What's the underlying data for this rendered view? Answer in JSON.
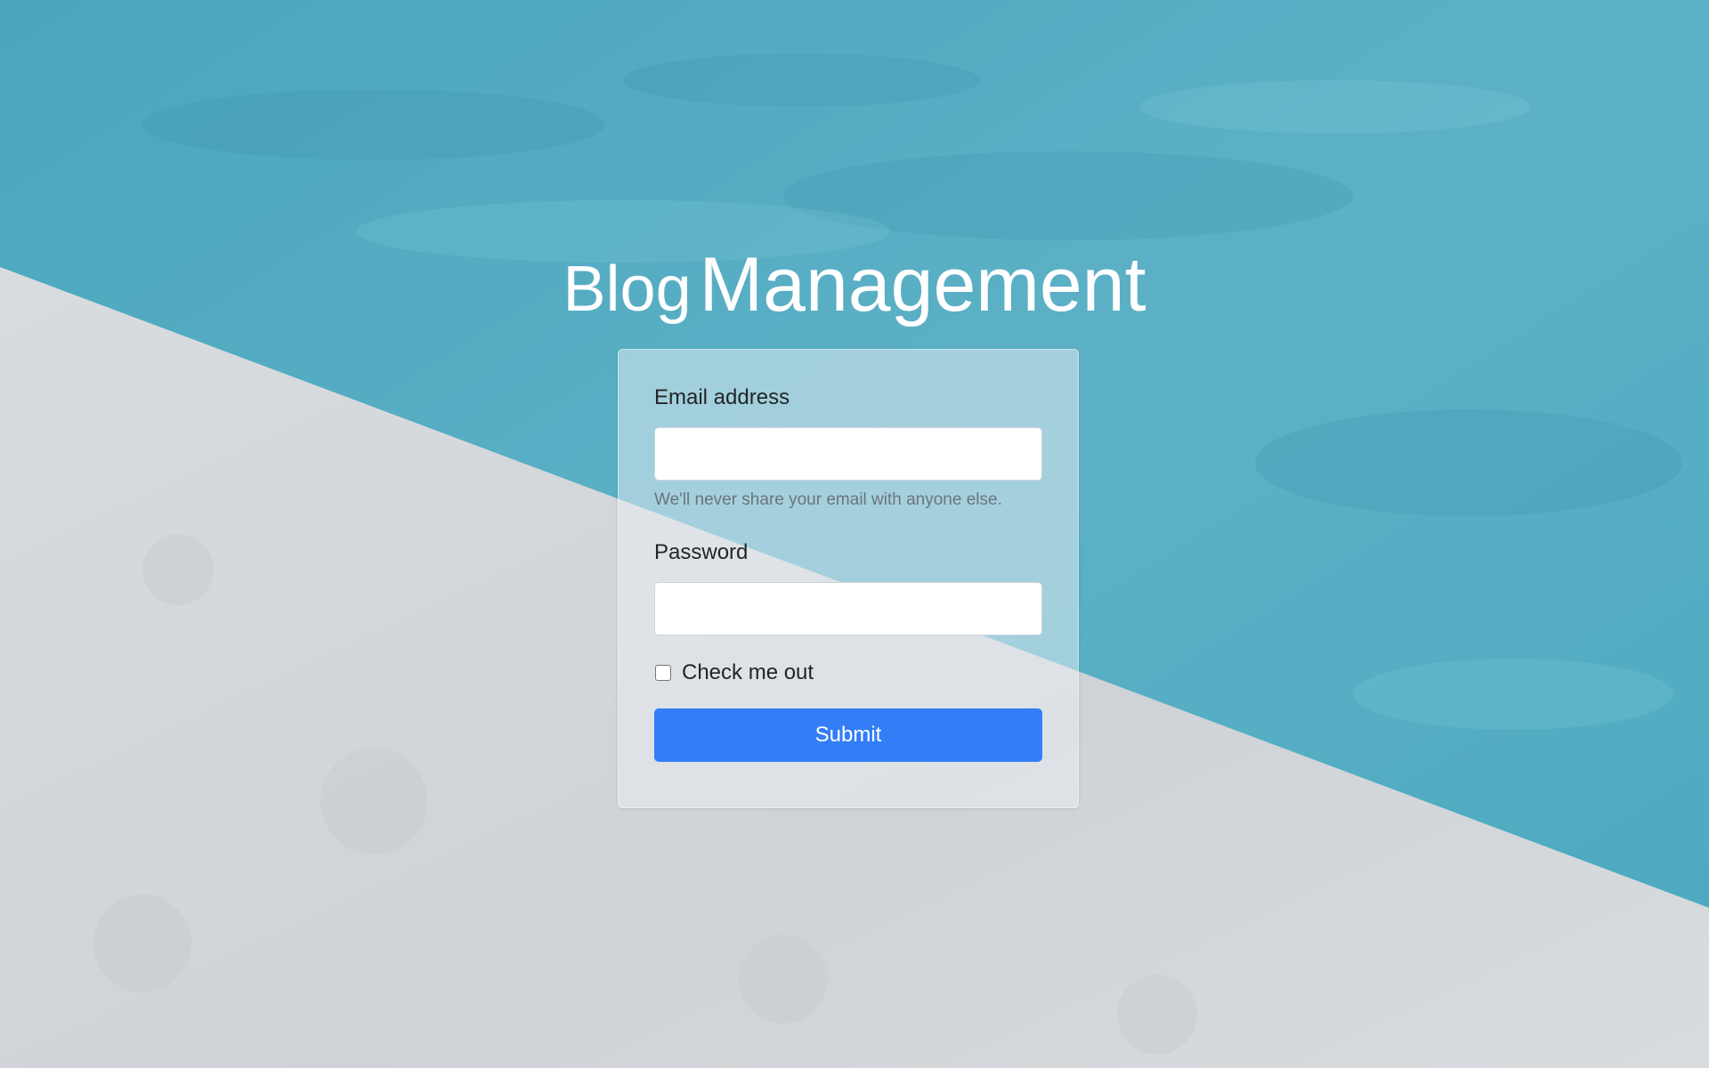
{
  "page": {
    "title_word_1": "Blog",
    "title_word_2": "Management"
  },
  "background": {
    "water_color": "#5aaec3",
    "concrete_color": "#d7dadd"
  },
  "login_form": {
    "email_label": "Email address",
    "email_value": "",
    "email_help": "We'll never share your email with anyone else.",
    "password_label": "Password",
    "password_value": "",
    "checkbox_label": "Check me out",
    "checkbox_checked": false,
    "submit_label": "Submit",
    "accent_color": "#337ef7"
  }
}
